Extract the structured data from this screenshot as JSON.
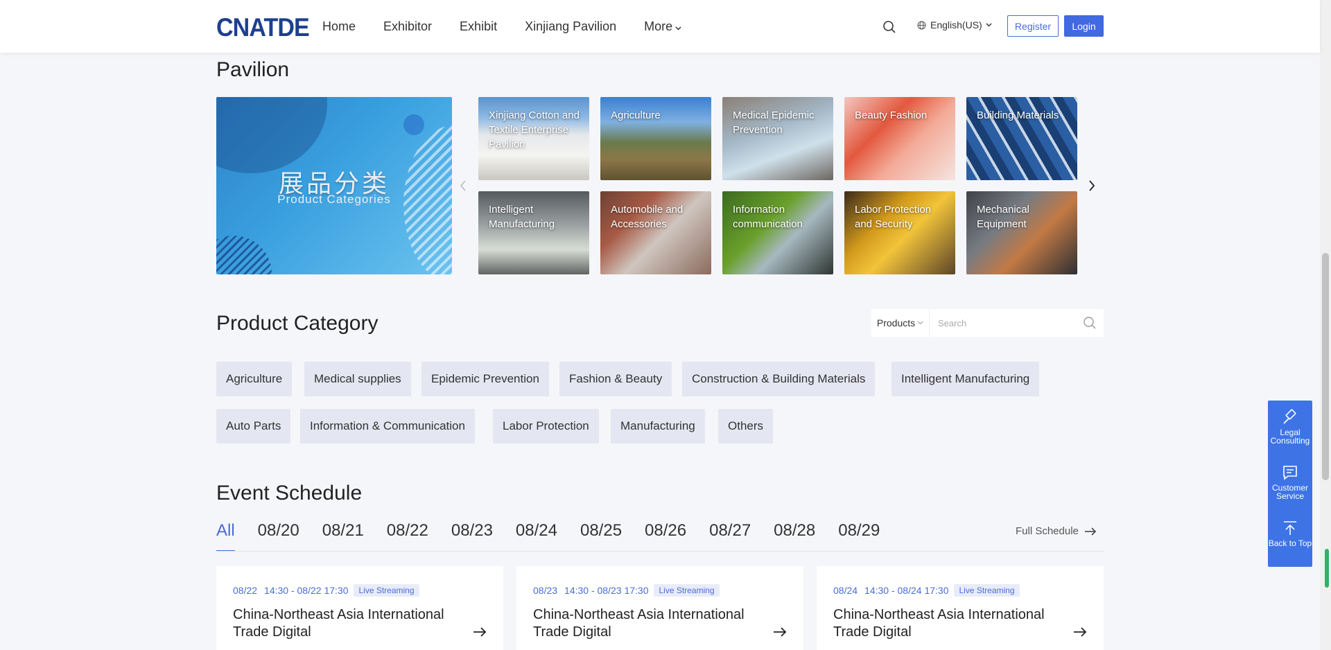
{
  "header": {
    "logo": "CNATDE",
    "nav": [
      "Home",
      "Exhibitor",
      "Exhibit",
      "Xinjiang Pavilion",
      "More"
    ],
    "language": "English(US)",
    "register": "Register",
    "login": "Login"
  },
  "pavilion": {
    "title": "Pavilion",
    "banner_cn": "展品分类",
    "banner_en": "Product Categories",
    "tiles": [
      "Xinjiang Cotton and Textile Enterprise Pavilion",
      "Agriculture",
      "Medical Epidemic Prevention",
      "Beauty Fashion",
      "Building Materials",
      "Intelligent Manufacturing",
      "Automobile and Accessories",
      "Information communication",
      "Labor Protection and Security",
      "Mechanical Equipment"
    ]
  },
  "product_category": {
    "title": "Product Category",
    "select_value": "Products",
    "search_placeholder": "Search",
    "tags": [
      "Agriculture",
      "Medical supplies",
      "Epidemic Prevention",
      "Fashion & Beauty",
      "Construction & Building Materials",
      "Intelligent Manufacturing",
      "Auto Parts",
      "Information & Communication",
      "Labor Protection",
      "Manufacturing",
      "Others"
    ]
  },
  "event_schedule": {
    "title": "Event Schedule",
    "tabs": [
      "All",
      "08/20",
      "08/21",
      "08/22",
      "08/23",
      "08/24",
      "08/25",
      "08/26",
      "08/27",
      "08/28",
      "08/29"
    ],
    "full_schedule": "Full Schedule",
    "cards": [
      {
        "date": "08/22",
        "time": "14:30 - 08/22  17:30",
        "badge": "Live Streaming",
        "title": "China-Northeast Asia International Trade Digital"
      },
      {
        "date": "08/23",
        "time": "14:30 - 08/23  17:30",
        "badge": "Live Streaming",
        "title": "China-Northeast Asia International Trade Digital"
      },
      {
        "date": "08/24",
        "time": "14:30 - 08/24  17:30",
        "badge": "Live Streaming",
        "title": "China-Northeast Asia International Trade Digital"
      }
    ]
  },
  "sidebar": {
    "legal": "Legal Consulting",
    "service": "Customer Service",
    "top": "Back to Top"
  },
  "colors": {
    "brand": "#1d3f8f",
    "accent": "#4169e1",
    "tag_bg": "#e4e6f1",
    "page_bg": "#f5f6f9"
  }
}
